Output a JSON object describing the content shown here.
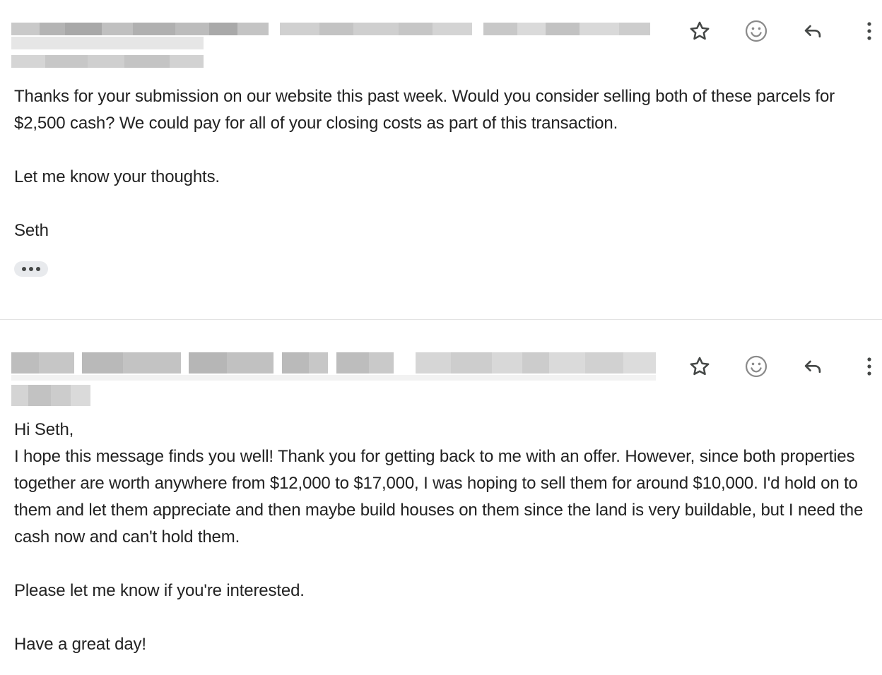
{
  "colors": {
    "text": "#222222",
    "icon": "#444746",
    "divider": "#e3e3e3",
    "ellipsis_bg": "#e8eaed",
    "redaction": "#bdbdbd"
  },
  "header_icons": [
    "star-icon",
    "emoji-icon",
    "reply-icon",
    "more-vert-icon"
  ],
  "messages": [
    {
      "sender_redacted": true,
      "body": {
        "p1": "Thanks for your submission on our website this past week. Would you consider selling both of these parcels for $2,500 cash? We could pay for all of your closing costs as part of this transaction.",
        "p2": "Let me know your thoughts.",
        "p3": "Seth"
      },
      "has_trimmed_content": true
    },
    {
      "sender_redacted": true,
      "body": {
        "p1": "Hi Seth,",
        "p2": "I hope this message finds you well! Thank you for getting back to me with an offer. However, since both properties together are worth anywhere from $12,000 to $17,000, I was hoping to sell them for around $10,000. I'd hold on to them and let them appreciate and then maybe build houses on them since the land is very buildable, but I need the cash now and can't hold them.",
        "p3": "Please let me know if you're interested.",
        "p4": "Have a great day!"
      }
    }
  ]
}
